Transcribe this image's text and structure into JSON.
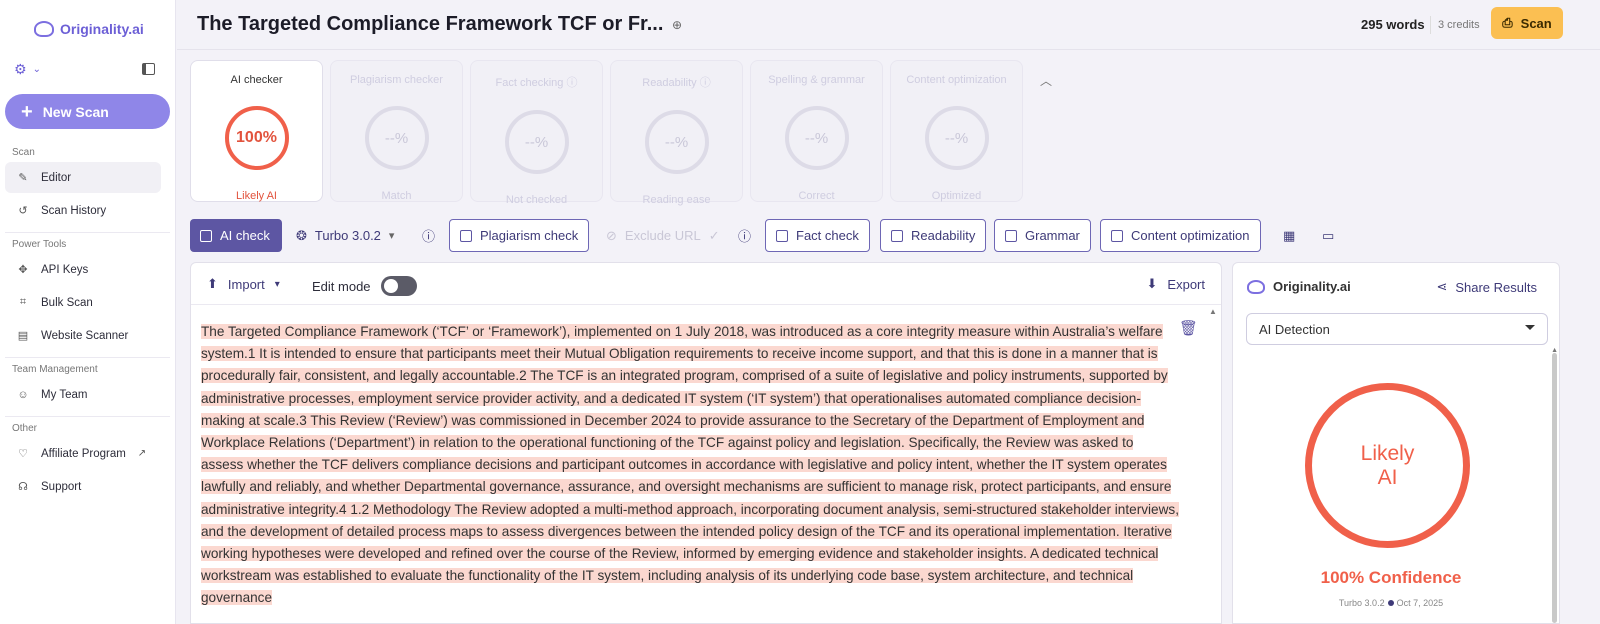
{
  "brand": {
    "name": "Originality.ai"
  },
  "sidebar": {
    "new_scan_label": "New Scan",
    "sections": {
      "scan": "Scan",
      "power_tools": "Power Tools",
      "team_management": "Team Management",
      "other": "Other"
    },
    "items": {
      "editor": "Editor",
      "scan_history": "Scan History",
      "api_keys": "API Keys",
      "bulk_scan": "Bulk Scan",
      "website_scanner": "Website Scanner",
      "my_team": "My Team",
      "affiliate_program": "Affiliate Program",
      "support": "Support"
    }
  },
  "header": {
    "title": "The Targeted Compliance Framework TCF or Fr...",
    "words": "295 words",
    "credits": "3 credits",
    "scan_label": "Scan"
  },
  "cards": [
    {
      "title": "AI checker",
      "value": "100%",
      "status": "Likely AI"
    },
    {
      "title": "Plagiarism checker",
      "value": "--%",
      "status": "Match"
    },
    {
      "title": "Fact checking ⓘ",
      "value": "--%",
      "status": "Not checked"
    },
    {
      "title": "Readability ⓘ",
      "value": "--%",
      "status": "Reading ease"
    },
    {
      "title": "Spelling & grammar",
      "value": "--%",
      "status": "Correct"
    },
    {
      "title": "Content optimization",
      "value": "--%",
      "status": "Optimized"
    }
  ],
  "toolbar": {
    "ai_check": "AI check",
    "model": "Turbo 3.0.2",
    "plagiarism_check": "Plagiarism check",
    "exclude_url": "Exclude URL",
    "fact_check": "Fact check",
    "readability": "Readability",
    "grammar": "Grammar",
    "content_optimization": "Content optimization"
  },
  "editor": {
    "import_label": "Import",
    "edit_mode_label": "Edit mode",
    "export_label": "Export",
    "text": "The Targeted Compliance Framework (‘TCF’ or ‘Framework’), implemented on 1 July 2018, was introduced as a core integrity measure within Australia’s welfare system.1 It is intended to ensure that participants meet their Mutual Obligation requirements to receive income support, and that this is done in a manner that is procedurally fair, consistent, and legally accountable.2 The TCF is an integrated program, comprised of a suite of legislative and policy instruments, supported by administrative processes, employment service provider activity, and a dedicated IT system (‘IT system’) that operationalises automated compliance decision-making at scale.3 This Review (‘Review’) was commissioned in December 2024 to provide assurance to the Secretary of the Department of Employment and Workplace Relations (‘Department’) in relation to the operational functioning of the TCF against policy and legislation. Specifically, the Review was asked to assess whether the TCF delivers compliance decisions and participant outcomes in accordance with legislative and policy intent, whether the IT system operates lawfully and reliably, and whether Departmental governance, assurance, and oversight mechanisms are sufficient to manage risk, protect participants, and ensure administrative integrity.4 1.2 Methodology The Review adopted a multi-method approach, incorporating document analysis, semi-structured stakeholder interviews, and the development of detailed process maps to assess divergences between the intended policy design of the TCF and its operational implementation. Iterative working hypotheses were developed and refined over the course of the Review, informed by emerging evidence and stakeholder insights. A dedicated technical workstream was established to evaluate the functionality of the IT system, including analysis of its underlying code base, system architecture, and technical governance"
  },
  "panel": {
    "brand": "Originality.ai",
    "share_label": "Share Results",
    "select_value": "AI Detection",
    "ring_line1": "Likely",
    "ring_line2": "AI",
    "confidence": "100% Confidence",
    "model": "Turbo 3.0.2",
    "date": "Oct 7, 2025"
  },
  "colors": {
    "accent": "#5d56a3",
    "ai_red": "#f0604a",
    "scan_button": "#fbbf52",
    "highlight": "#fbd8d0"
  }
}
